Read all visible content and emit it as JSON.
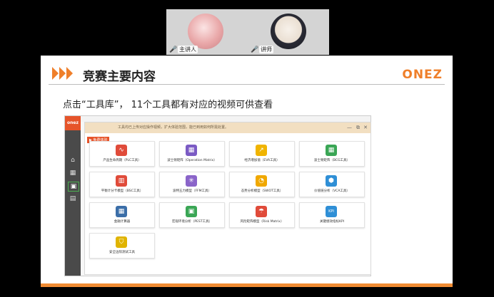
{
  "video": {
    "host": {
      "label": "主讲人"
    },
    "speaker": {
      "label": "讲师"
    }
  },
  "slide": {
    "title": "竞赛主要内容",
    "logo": "ONEZ",
    "subtitle": "点击“工具库”， 11个工具都有对应的视频可供查看"
  },
  "app": {
    "brand": "onez",
    "trial_badge": "▶ 免费体验",
    "header_text": "工具均已上传对应操作视频，扩大体验范围，能已到用如何所需处置。",
    "window_controls": [
      "—",
      "⧉",
      "✕"
    ],
    "sidebar_icons": [
      "⌂",
      "▦",
      "▣",
      "▤"
    ],
    "tools": [
      {
        "label": "产品生命周期（PLC工具）",
        "icon": "pulse-icon",
        "color": "#e04b3a",
        "glyph": "∿"
      },
      {
        "label": "波士顿矩阵（Operation Matrix）",
        "icon": "grid-icon",
        "color": "#7b5bc4",
        "glyph": "▦"
      },
      {
        "label": "经济增加值（EVA工具）",
        "icon": "chart-up-icon",
        "color": "#f0b400",
        "glyph": "↗"
      },
      {
        "label": "波士顿矩阵（BCG工具）",
        "icon": "matrix-icon",
        "color": "#3aa655",
        "glyph": "▦"
      },
      {
        "label": "平衡计分卡模型（BSC工具）",
        "icon": "scorecard-icon",
        "color": "#e04b3a",
        "glyph": "▥"
      },
      {
        "label": "波特五力模型（FFM工具）",
        "icon": "five-forces-icon",
        "color": "#8a64c9",
        "glyph": "✳"
      },
      {
        "label": "态势分析模型（SWOT工具）",
        "icon": "pie-icon",
        "color": "#f0a800",
        "glyph": "◔"
      },
      {
        "label": "价值链分析（VCA工具）",
        "icon": "chain-icon",
        "color": "#2f8fd6",
        "glyph": "⬢"
      },
      {
        "label": "金融计算器",
        "icon": "calculator-icon",
        "color": "#3b6ea8",
        "glyph": "▦"
      },
      {
        "label": "宏观环境分析（PEST工具）",
        "icon": "environment-icon",
        "color": "#3aa655",
        "glyph": "▣"
      },
      {
        "label": "风险矩阵模型（Risk Matrix）",
        "icon": "umbrella-icon",
        "color": "#e04b3a",
        "glyph": "☂"
      },
      {
        "label": "关键绩效指标KPI",
        "icon": "kpi-icon",
        "color": "#2f8fd6",
        "glyph": "KPI"
      },
      {
        "label": "安全边际测试工具",
        "icon": "shield-icon",
        "color": "#e0b400",
        "glyph": "⛉"
      }
    ]
  }
}
